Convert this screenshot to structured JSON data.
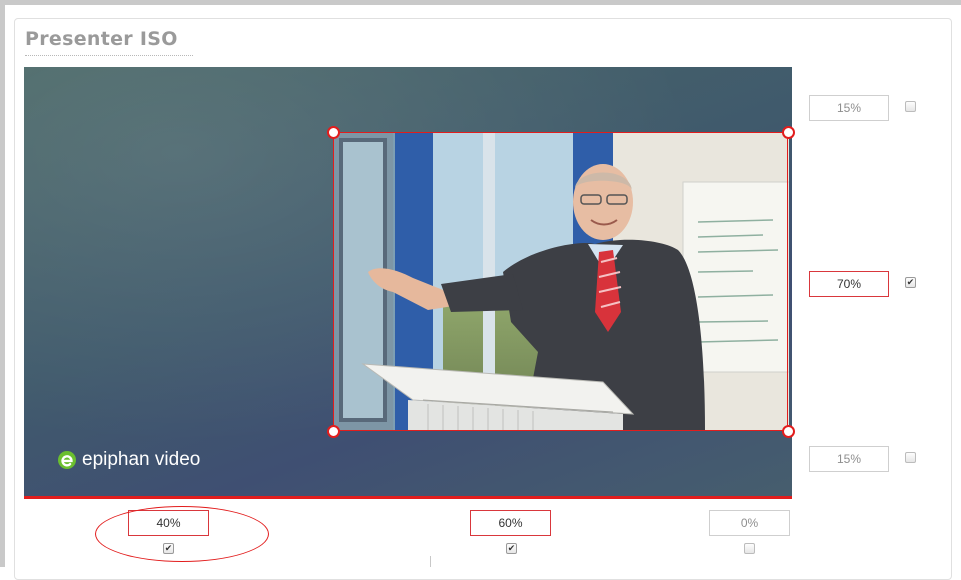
{
  "panel": {
    "title": "Presenter ISO"
  },
  "canvas": {
    "logo_text": "epiphan video"
  },
  "colors": {
    "accent": "#e21d1d",
    "title": "#9a9a9a",
    "background_start": "#4a6868",
    "background_end": "#3f4f72"
  },
  "vertical_controls": [
    {
      "value": "15%",
      "checked": false
    },
    {
      "value": "70%",
      "checked": true
    },
    {
      "value": "15%",
      "checked": false
    }
  ],
  "horizontal_controls": [
    {
      "value": "40%",
      "checked": true
    },
    {
      "value": "60%",
      "checked": true
    },
    {
      "value": "0%",
      "checked": false
    }
  ],
  "icons": {
    "logo": "epiphan-logo-icon",
    "check": "checkmark-icon"
  }
}
